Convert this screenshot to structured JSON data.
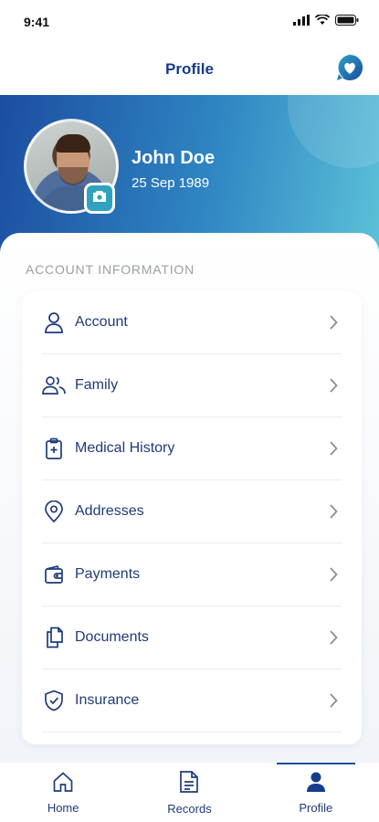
{
  "status": {
    "time": "9:41"
  },
  "header": {
    "title": "Profile"
  },
  "profile": {
    "name": "John Doe",
    "dob": "25 Sep 1989"
  },
  "section": {
    "title": "ACCOUNT INFORMATION"
  },
  "menu": [
    {
      "label": "Account",
      "icon": "user-icon"
    },
    {
      "label": "Family",
      "icon": "family-icon"
    },
    {
      "label": "Medical History",
      "icon": "clipboard-plus-icon"
    },
    {
      "label": "Addresses",
      "icon": "location-pin-icon"
    },
    {
      "label": "Payments",
      "icon": "wallet-icon"
    },
    {
      "label": "Documents",
      "icon": "documents-icon"
    },
    {
      "label": "Insurance",
      "icon": "shield-check-icon"
    }
  ],
  "nav": [
    {
      "label": "Home",
      "icon": "home-icon",
      "active": false
    },
    {
      "label": "Records",
      "icon": "records-icon",
      "active": false
    },
    {
      "label": "Profile",
      "icon": "profile-icon",
      "active": true
    }
  ],
  "colors": {
    "primary": "#173c8c",
    "accent": "#2fa3bd",
    "gradient_start": "#1c4da0",
    "gradient_end": "#5cc1d8"
  }
}
